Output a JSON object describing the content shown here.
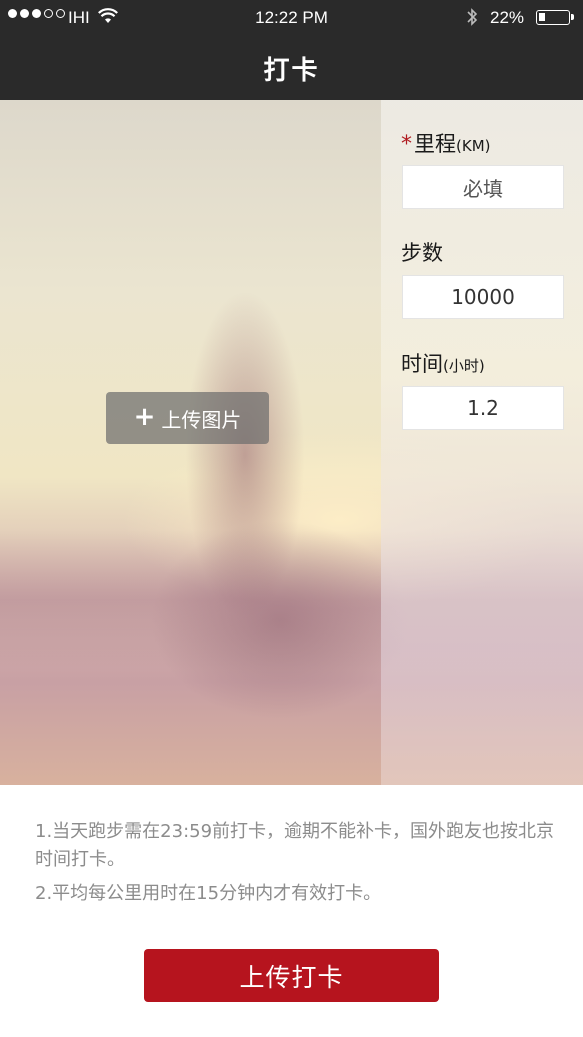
{
  "status_bar": {
    "carrier": "IHI",
    "time": "12:22 PM",
    "battery_percent": "22%",
    "signal_bars": 3,
    "icons": [
      "signal-icon",
      "wifi-icon",
      "bluetooth-icon",
      "battery-icon"
    ]
  },
  "nav": {
    "title": "打卡"
  },
  "photo": {
    "upload_label": "上传图片"
  },
  "form": {
    "distance": {
      "label": "里程",
      "unit": "(KM)",
      "required_mark": "*",
      "placeholder": "必填"
    },
    "steps": {
      "label": "步数",
      "value": "10000"
    },
    "duration": {
      "label": "时间",
      "unit": "(小时)",
      "value": "1.2"
    }
  },
  "notes": [
    "1.当天跑步需在23:59前打卡，逾期不能补卡，国外跑友也按北京时间打卡。",
    "2.平均每公里用时在15分钟内才有效打卡。"
  ],
  "submit_label": "上传打卡",
  "colors": {
    "accent": "#b6141e",
    "header_bg": "#2a2a2a",
    "note_text": "#8c8c8c"
  }
}
